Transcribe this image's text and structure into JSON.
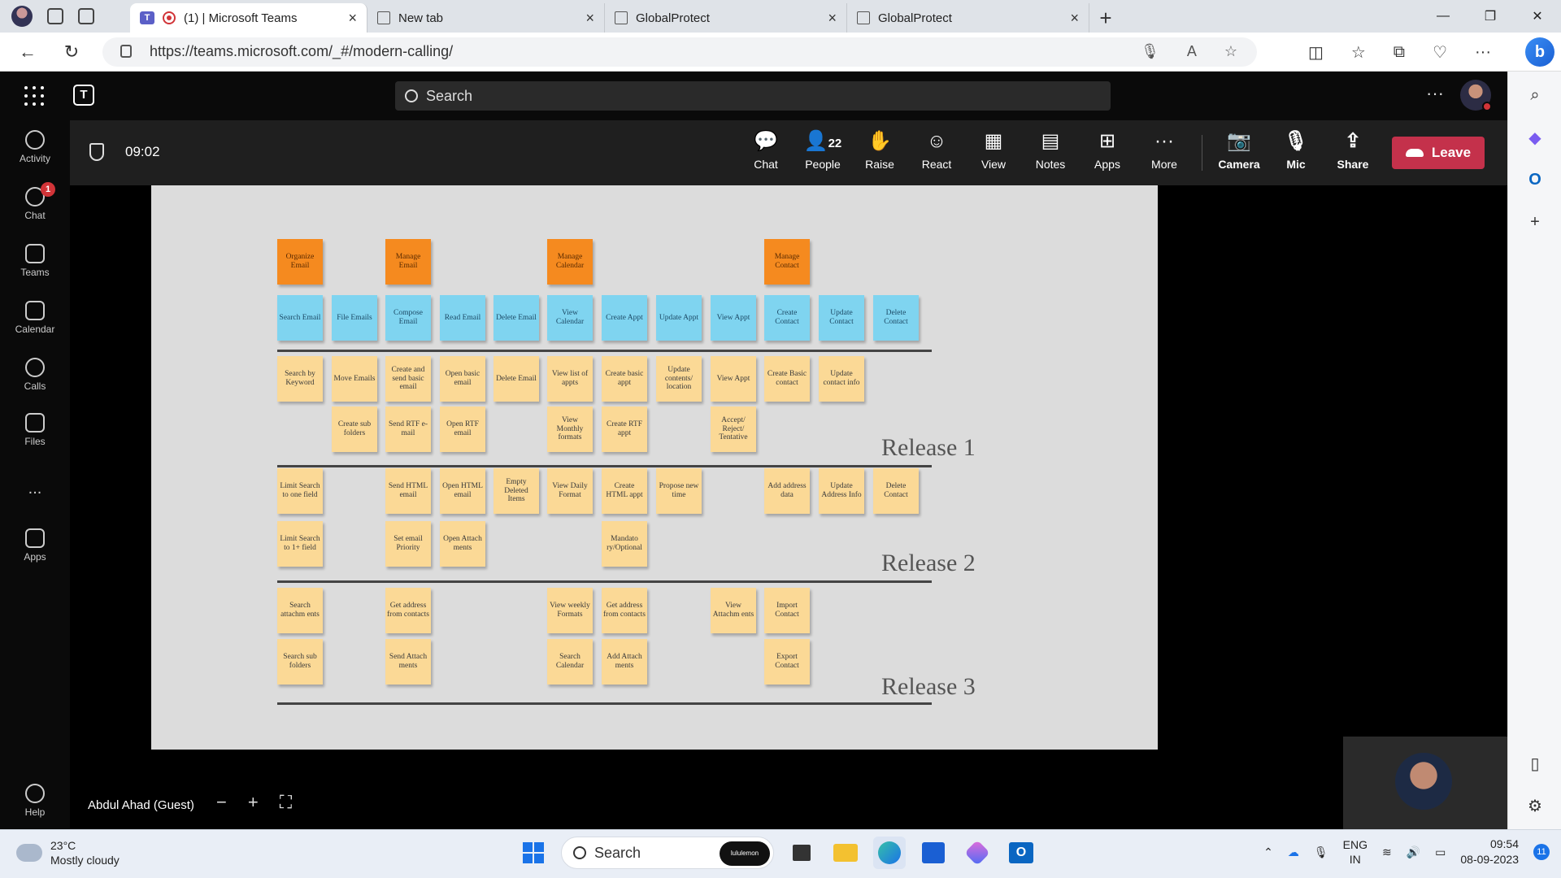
{
  "browser": {
    "tabs": [
      {
        "title": "(1) | Microsoft Teams",
        "active": true
      },
      {
        "title": "New tab",
        "active": false
      },
      {
        "title": "GlobalProtect",
        "active": false
      },
      {
        "title": "GlobalProtect",
        "active": false
      }
    ],
    "url": "https://teams.microsoft.com/_#/modern-calling/"
  },
  "teams": {
    "search_placeholder": "Search",
    "rail": [
      {
        "label": "Activity"
      },
      {
        "label": "Chat",
        "badge": "1"
      },
      {
        "label": "Teams"
      },
      {
        "label": "Calendar"
      },
      {
        "label": "Calls"
      },
      {
        "label": "Files"
      },
      {
        "label": "..."
      },
      {
        "label": "Apps"
      },
      {
        "label": "Help"
      }
    ]
  },
  "meeting": {
    "time": "09:02",
    "people_count": "22",
    "buttons": {
      "chat": "Chat",
      "people": "People",
      "raise": "Raise",
      "react": "React",
      "view": "View",
      "notes": "Notes",
      "apps": "Apps",
      "more": "More",
      "camera": "Camera",
      "mic": "Mic",
      "share": "Share",
      "leave": "Leave"
    },
    "presenter": "Abdul Ahad (Guest)"
  },
  "slide": {
    "releases": [
      "Release 1",
      "Release 2",
      "Release 3"
    ],
    "stickies": [
      {
        "text": "Organize Email",
        "color": "orange",
        "col": 0,
        "row": 0
      },
      {
        "text": "Manage Email",
        "color": "orange",
        "col": 2,
        "row": 0
      },
      {
        "text": "Manage Calendar",
        "color": "orange",
        "col": 5,
        "row": 0
      },
      {
        "text": "Manage Contact",
        "color": "orange",
        "col": 9,
        "row": 0
      },
      {
        "text": "Search Email",
        "color": "blue",
        "col": 0,
        "row": 1
      },
      {
        "text": "File Emails",
        "color": "blue",
        "col": 1,
        "row": 1
      },
      {
        "text": "Compose Email",
        "color": "blue",
        "col": 2,
        "row": 1
      },
      {
        "text": "Read Email",
        "color": "blue",
        "col": 3,
        "row": 1
      },
      {
        "text": "Delete Email",
        "color": "blue",
        "col": 4,
        "row": 1
      },
      {
        "text": "View Calendar",
        "color": "blue",
        "col": 5,
        "row": 1
      },
      {
        "text": "Create Appt",
        "color": "blue",
        "col": 6,
        "row": 1
      },
      {
        "text": "Update Appt",
        "color": "blue",
        "col": 7,
        "row": 1
      },
      {
        "text": "View Appt",
        "color": "blue",
        "col": 8,
        "row": 1
      },
      {
        "text": "Create Contact",
        "color": "blue",
        "col": 9,
        "row": 1
      },
      {
        "text": "Update Contact",
        "color": "blue",
        "col": 10,
        "row": 1
      },
      {
        "text": "Delete Contact",
        "color": "blue",
        "col": 11,
        "row": 1
      },
      {
        "text": "Search by Keyword",
        "color": "yellow",
        "col": 0,
        "row": 2
      },
      {
        "text": "Move Emails",
        "color": "yellow",
        "col": 1,
        "row": 2
      },
      {
        "text": "Create and send basic email",
        "color": "yellow",
        "col": 2,
        "row": 2
      },
      {
        "text": "Open basic email",
        "color": "yellow",
        "col": 3,
        "row": 2
      },
      {
        "text": "Delete Email",
        "color": "yellow",
        "col": 4,
        "row": 2
      },
      {
        "text": "View list of appts",
        "color": "yellow",
        "col": 5,
        "row": 2
      },
      {
        "text": "Create basic appt",
        "color": "yellow",
        "col": 6,
        "row": 2
      },
      {
        "text": "Update contents/ location",
        "color": "yellow",
        "col": 7,
        "row": 2
      },
      {
        "text": "View Appt",
        "color": "yellow",
        "col": 8,
        "row": 2
      },
      {
        "text": "Create Basic contact",
        "color": "yellow",
        "col": 9,
        "row": 2
      },
      {
        "text": "Update contact info",
        "color": "yellow",
        "col": 10,
        "row": 2
      },
      {
        "text": "Create sub folders",
        "color": "yellow",
        "col": 1,
        "row": 3
      },
      {
        "text": "Send RTF e-mail",
        "color": "yellow",
        "col": 2,
        "row": 3
      },
      {
        "text": "Open RTF email",
        "color": "yellow",
        "col": 3,
        "row": 3
      },
      {
        "text": "View Monthly formats",
        "color": "yellow",
        "col": 5,
        "row": 3
      },
      {
        "text": "Create RTF appt",
        "color": "yellow",
        "col": 6,
        "row": 3
      },
      {
        "text": "Accept/ Reject/ Tentative",
        "color": "yellow",
        "col": 8,
        "row": 3
      },
      {
        "text": "Limit Search to one field",
        "color": "yellow",
        "col": 0,
        "row": 4
      },
      {
        "text": "Send HTML email",
        "color": "yellow",
        "col": 2,
        "row": 4
      },
      {
        "text": "Open HTML email",
        "color": "yellow",
        "col": 3,
        "row": 4
      },
      {
        "text": "Empty Deleted Items",
        "color": "yellow",
        "col": 4,
        "row": 4
      },
      {
        "text": "View Daily Format",
        "color": "yellow",
        "col": 5,
        "row": 4
      },
      {
        "text": "Create HTML appt",
        "color": "yellow",
        "col": 6,
        "row": 4
      },
      {
        "text": "Propose new time",
        "color": "yellow",
        "col": 7,
        "row": 4
      },
      {
        "text": "Add address data",
        "color": "yellow",
        "col": 9,
        "row": 4
      },
      {
        "text": "Update Address Info",
        "color": "yellow",
        "col": 10,
        "row": 4
      },
      {
        "text": "Delete Contact",
        "color": "yellow",
        "col": 11,
        "row": 4
      },
      {
        "text": "Limit Search to 1+ field",
        "color": "yellow",
        "col": 0,
        "row": 5
      },
      {
        "text": "Set email Priority",
        "color": "yellow",
        "col": 2,
        "row": 5
      },
      {
        "text": "Open Attach ments",
        "color": "yellow",
        "col": 3,
        "row": 5
      },
      {
        "text": "Mandato ry/Optional",
        "color": "yellow",
        "col": 6,
        "row": 5
      },
      {
        "text": "Search attachm ents",
        "color": "yellow",
        "col": 0,
        "row": 6
      },
      {
        "text": "Get address from contacts",
        "color": "yellow",
        "col": 2,
        "row": 6
      },
      {
        "text": "View weekly Formats",
        "color": "yellow",
        "col": 5,
        "row": 6
      },
      {
        "text": "Get address from contacts",
        "color": "yellow",
        "col": 6,
        "row": 6
      },
      {
        "text": "View Attachm ents",
        "color": "yellow",
        "col": 8,
        "row": 6
      },
      {
        "text": "Import Contact",
        "color": "yellow",
        "col": 9,
        "row": 6
      },
      {
        "text": "Search sub folders",
        "color": "yellow",
        "col": 0,
        "row": 7
      },
      {
        "text": "Send Attach ments",
        "color": "yellow",
        "col": 2,
        "row": 7
      },
      {
        "text": "Search Calendar",
        "color": "yellow",
        "col": 5,
        "row": 7
      },
      {
        "text": "Add Attach ments",
        "color": "yellow",
        "col": 6,
        "row": 7
      },
      {
        "text": "Export Contact",
        "color": "yellow",
        "col": 9,
        "row": 7
      }
    ]
  },
  "taskbar": {
    "temp": "23°C",
    "weather": "Mostly cloudy",
    "search": "Search",
    "promo": "lululemon",
    "lang1": "ENG",
    "lang2": "IN",
    "time": "09:54",
    "date": "08-09-2023",
    "notifications": "11"
  }
}
